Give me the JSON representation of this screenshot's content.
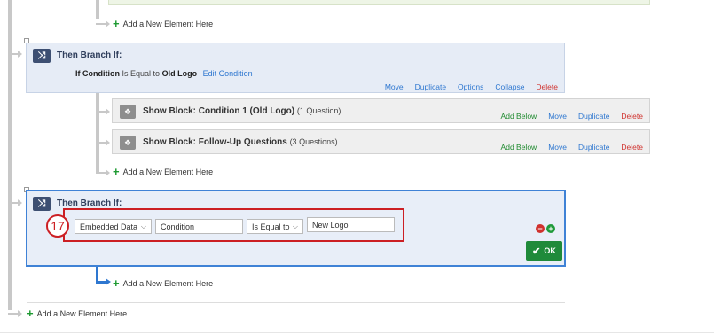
{
  "top_add_element": "Add a New Element Here",
  "branch1": {
    "title": "Then Branch If:",
    "cond_if": "If",
    "cond_field": "Condition",
    "cond_op": "Is Equal to",
    "cond_value": "Old Logo",
    "edit_label": "Edit Condition",
    "actions": [
      "Move",
      "Duplicate",
      "Options",
      "Collapse",
      "Delete"
    ]
  },
  "blocks": [
    {
      "title": "Show Block: Condition 1 (Old Logo)",
      "sub": "(1 Question)",
      "actions": [
        "Add Below",
        "Move",
        "Duplicate",
        "Delete"
      ]
    },
    {
      "title": "Show Block: Follow-Up Questions",
      "sub": "(3 Questions)",
      "actions": [
        "Add Below",
        "Move",
        "Duplicate",
        "Delete"
      ]
    }
  ],
  "branch1_add_element": "Add a New Element Here",
  "branch2": {
    "title": "Then Branch If:",
    "type_select": "Embedded Data",
    "field_input": "Condition",
    "op_select": "Is Equal to",
    "value_input": "New Logo",
    "ok_label": "OK",
    "step_number": "17"
  },
  "branch2_add_element": "Add a New Element Here",
  "root_add_element": "Add a New Element Here",
  "colors": {
    "accent": "#2e77d0",
    "delete": "#d0312d",
    "ok": "#1f8a3a",
    "highlight": "#cc1f24"
  }
}
